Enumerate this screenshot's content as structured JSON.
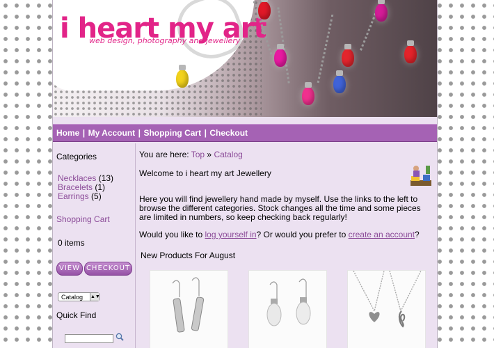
{
  "header": {
    "logo_title": "i heart my art",
    "logo_tagline": "web design, photography and jewellery"
  },
  "nav": {
    "items": [
      "Home",
      "My Account",
      "Shopping Cart",
      "Checkout"
    ],
    "separator": "|"
  },
  "sidebar": {
    "categories_heading": "Categories",
    "categories": [
      {
        "label": "Necklaces",
        "count": "(13)"
      },
      {
        "label": "Bracelets",
        "count": "(1)"
      },
      {
        "label": "Earrings",
        "count": "(5)"
      }
    ],
    "cart_heading": "Shopping Cart",
    "cart_items": "0 items",
    "view_button": "VIEW",
    "checkout_button": "CHECKOUT",
    "catalog_select": "Catalog",
    "quick_find_heading": "Quick Find"
  },
  "main": {
    "breadcrumb_prefix": "You are here: ",
    "breadcrumb_top": "Top",
    "breadcrumb_sep": " » ",
    "breadcrumb_catalog": "Catalog",
    "welcome": "Welcome to i heart my art Jewellery",
    "intro": "Here you will find jewellery hand made by myself. Use the links to the left to browse the different categories. Stock changes all the time and some pieces are limited in numbers, so keep checking back regularly!",
    "login_prefix": "Would you like to ",
    "login_link": "log yourself in",
    "login_mid": "? Or would you prefer to ",
    "create_link": "create an account",
    "login_suffix": "?",
    "new_products_heading": "New Products For August"
  },
  "icons": {
    "search": "magnifier-icon",
    "store": "shop-keeper-icon"
  },
  "colors": {
    "accent": "#a562b4",
    "link": "#8b4b98",
    "logo_pink": "#e22488",
    "page_bg": "#ece1f1"
  }
}
